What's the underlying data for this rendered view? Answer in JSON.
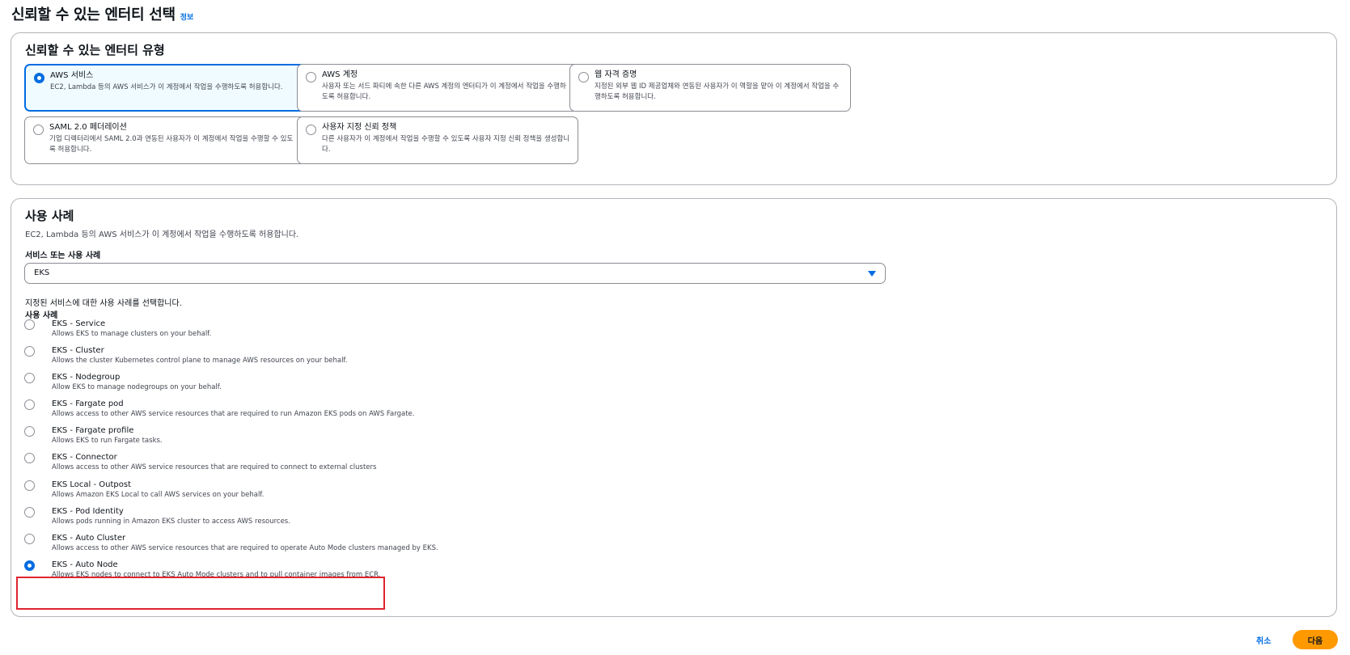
{
  "header": {
    "title": "신뢰할 수 있는 엔터티 선택",
    "info_link": "정보"
  },
  "entity_type": {
    "title": "신뢰할 수 있는 엔터티 유형",
    "selected": "aws-service",
    "tiles": [
      {
        "id": "aws-service",
        "label": "AWS 서비스",
        "desc": "EC2, Lambda 등의 AWS 서비스가 이 계정에서 작업을 수행하도록 허용합니다.",
        "selected": true
      },
      {
        "id": "aws-account",
        "label": "AWS 계정",
        "desc": "사용자 또는 서드 파티에 속한 다른 AWS 계정의 엔터티가 이 계정에서 작업을 수행하도록 허용합니다.",
        "selected": false
      },
      {
        "id": "web-identity",
        "label": "웹 자격 증명",
        "desc": "지정된 외부 웹 ID 제공업체와 연동된 사용자가 이 역할을 맡아 이 계정에서 작업을 수행하도록 허용합니다.",
        "selected": false
      },
      {
        "id": "saml",
        "label": "SAML 2.0 페더레이션",
        "desc": "기업 디렉터리에서 SAML 2.0과 연동된 사용자가 이 계정에서 작업을 수행할 수 있도록 허용합니다.",
        "selected": false
      },
      {
        "id": "custom-trust",
        "label": "사용자 지정 신뢰 정책",
        "desc": "다른 사용자가 이 계정에서 작업을 수행할 수 있도록 사용자 지정 신뢰 정책을 생성합니다.",
        "selected": false
      }
    ]
  },
  "use_case": {
    "title": "사용 사례",
    "desc": "EC2, Lambda 등의 AWS 서비스가 이 계정에서 작업을 수행하도록 허용합니다.",
    "field_label": "서비스 또는 사용 사례",
    "select_value": "EKS",
    "hint": "지정된 서비스에 대한 사용 사례를 선택합니다.",
    "group_label": "사용 사례",
    "options": [
      {
        "label": "EKS - Service",
        "desc": "Allows EKS to manage clusters on your behalf.",
        "selected": false
      },
      {
        "label": "EKS - Cluster",
        "desc": "Allows the cluster Kubernetes control plane to manage AWS resources on your behalf.",
        "selected": false
      },
      {
        "label": "EKS - Nodegroup",
        "desc": "Allow EKS to manage nodegroups on your behalf.",
        "selected": false
      },
      {
        "label": "EKS - Fargate pod",
        "desc": "Allows access to other AWS service resources that are required to run Amazon EKS pods on AWS Fargate.",
        "selected": false
      },
      {
        "label": "EKS - Fargate profile",
        "desc": "Allows EKS to run Fargate tasks.",
        "selected": false
      },
      {
        "label": "EKS - Connector",
        "desc": "Allows access to other AWS service resources that are required to connect to external clusters",
        "selected": false
      },
      {
        "label": "EKS Local - Outpost",
        "desc": "Allows Amazon EKS Local to call AWS services on your behalf.",
        "selected": false
      },
      {
        "label": "EKS - Pod Identity",
        "desc": "Allows pods running in Amazon EKS cluster to access AWS resources.",
        "selected": false
      },
      {
        "label": "EKS - Auto Cluster",
        "desc": "Allows access to other AWS service resources that are required to operate Auto Mode clusters managed by EKS.",
        "selected": false
      },
      {
        "label": "EKS - Auto Node",
        "desc": "Allows EKS nodes to connect to EKS Auto Mode clusters and to pull container images from ECR.",
        "selected": true
      }
    ]
  },
  "footer": {
    "cancel_label": "취소",
    "next_label": "다음"
  },
  "colors": {
    "accent": "#006ce0",
    "primary_button": "#ff9900",
    "highlight": "#e0242e"
  }
}
